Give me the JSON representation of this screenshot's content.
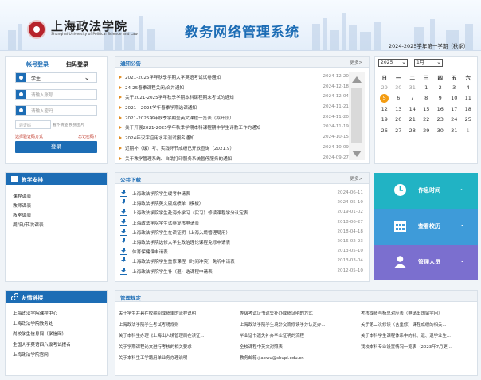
{
  "header": {
    "logo_cn": "上海政法学院",
    "logo_en": "Shanghai University of Political Science and Law",
    "system_title": "教务网络管理系统",
    "semester": "2024-2025学年第一学期（秋季）"
  },
  "login": {
    "tab_account": "帐号登录",
    "tab_scan": "扫码登录",
    "role_value": "学生",
    "username_placeholder": "请输入账号",
    "password_placeholder": "请输入密码",
    "captcha_placeholder": "验证码",
    "captcha_tip": "看不清楚  换张图片",
    "forgot_left": "选择验证码方式",
    "forgot_right": "忘记密码？",
    "submit": "登录"
  },
  "notice": {
    "title": "通知公告",
    "more": "更多>",
    "items": [
      {
        "title": "2021-2025学年秋季学期大学英语考试试卷通知",
        "date": "2024-12-20"
      },
      {
        "title": "24-25春季课程关闭/合并通知",
        "date": "2024-12-18"
      },
      {
        "title": "关于2021-2025学年秋季学期本科课程期末考试的通知",
        "date": "2024-12-04"
      },
      {
        "title": "2021 - 2025学年春季学期选课通知",
        "date": "2024-11-21"
      },
      {
        "title": "2021-2025学年秋季学期全英文课程一览表（拟开设）",
        "date": "2024-11-20"
      },
      {
        "title": "关于开展2021-2025学年秋季学期本科课程期中学生评教工作的通知",
        "date": "2024-11-19"
      },
      {
        "title": "2024年汉字应用水平测试报名通知",
        "date": "2024-10-15"
      },
      {
        "title": "近期补（缓）考、实践环节成绩已开放查询（2021.9）",
        "date": "2024-10-09"
      },
      {
        "title": "关于教学管理系统、自助打印服务系统暂停服务的通知",
        "date": "2024-09-27"
      }
    ]
  },
  "calendar": {
    "year": "2025",
    "month": "1月",
    "weekdays": [
      "日",
      "一",
      "二",
      "三",
      "四",
      "五",
      "六"
    ],
    "weeks": [
      [
        {
          "d": "29",
          "m": true
        },
        {
          "d": "30",
          "m": true
        },
        {
          "d": "31",
          "m": true
        },
        {
          "d": "1"
        },
        {
          "d": "2"
        },
        {
          "d": "3"
        },
        {
          "d": "4"
        }
      ],
      [
        {
          "d": "5",
          "today": true
        },
        {
          "d": "6"
        },
        {
          "d": "7"
        },
        {
          "d": "8"
        },
        {
          "d": "9"
        },
        {
          "d": "10"
        },
        {
          "d": "11"
        }
      ],
      [
        {
          "d": "12"
        },
        {
          "d": "13"
        },
        {
          "d": "14"
        },
        {
          "d": "15"
        },
        {
          "d": "16"
        },
        {
          "d": "17"
        },
        {
          "d": "18"
        }
      ],
      [
        {
          "d": "19"
        },
        {
          "d": "20"
        },
        {
          "d": "21"
        },
        {
          "d": "22"
        },
        {
          "d": "23"
        },
        {
          "d": "24"
        },
        {
          "d": "25"
        }
      ],
      [
        {
          "d": "26"
        },
        {
          "d": "27"
        },
        {
          "d": "28"
        },
        {
          "d": "29"
        },
        {
          "d": "30"
        },
        {
          "d": "31"
        },
        {
          "d": "1",
          "m": true
        }
      ]
    ]
  },
  "course": {
    "title": "教学安排",
    "links": [
      "课程课表",
      "教师课表",
      "教室课表",
      "周/日/节次课表"
    ]
  },
  "downloads": {
    "title": "公共下载",
    "more": "更多>",
    "items": [
      {
        "title": "上海政法学院学生缓考申请表",
        "date": "2024-06-11"
      },
      {
        "title": "上海政法学院英文版成绩单（模板）",
        "date": "2024-05-10"
      },
      {
        "title": "上海政法学院学生赴海外学习（实习）修读课程学分认定表",
        "date": "2019-01-02"
      },
      {
        "title": "上海政法学院学生试卷复核申请表",
        "date": "2018-06-27"
      },
      {
        "title": "上海政法学院学生在读证明（上海入境管理局用）",
        "date": "2018-04-18"
      },
      {
        "title": "上海政法学院选修大学生政治理论课程免修申请表",
        "date": "2016-02-23"
      },
      {
        "title": "体育保健课申请表",
        "date": "2013-05-10"
      },
      {
        "title": "上海政法学院学生重修课程（时间冲突）免听申请表",
        "date": "2013-03-04"
      },
      {
        "title": "上海政法学院学生补（退）选课程申请表",
        "date": "2012-05-10"
      }
    ]
  },
  "tiles": {
    "time": "作息时间",
    "room": "查看校历",
    "staff": "管理人员",
    "chevron": "⌄"
  },
  "friend_links": {
    "title": "友情链接",
    "items": [
      "上海政法学院课程中心",
      "上海政法学院教务处",
      "尚校学生信息网（学信网）",
      "全国大学英语四六级考试报名",
      "上海政法学院官网"
    ]
  },
  "rules": {
    "title": "管理规定",
    "items": [
      "关于学生并具在校期间成绩单的流程说明",
      "等级考试证书遗失补办成绩证明的方式",
      "考核成绩与杨总对应表（申请出国留学用）",
      "上海政法学院学生考试考场规则",
      "上海政法学院学生境外交流修读学分认定办...",
      "关于第二次修读（含重修）课程成绩的相关...",
      "关于本科生办理《上海出入境管理局在读证...",
      "毕业证书遗失补办毕业证明的流程",
      "关于本科学生课程体系中的补、退、退学业生...",
      "关于学期课程论文进行考核的相关要求",
      "全校课程中英文对照表",
      "我校本科专业设置情况一览表（2023年7月更...",
      "关于本科生工学籍用单业务办理说明",
      "教务邮箱:jiaowu@shupl.edu.cn"
    ]
  },
  "colors": {
    "accent": "#1d6db5",
    "tile_time": "#21b3c4",
    "tile_room": "#3e9bd9",
    "tile_staff": "#7b6fcf",
    "today": "#f39c12"
  }
}
